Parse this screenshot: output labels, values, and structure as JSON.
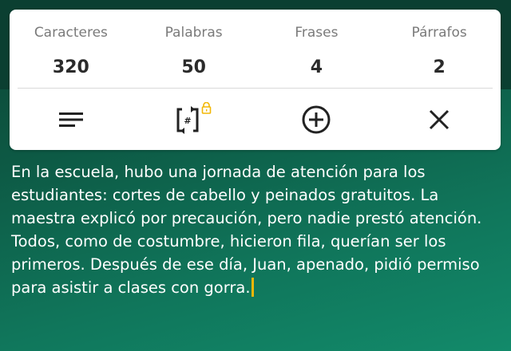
{
  "stats": [
    {
      "label": "Caracteres",
      "value": "320"
    },
    {
      "label": "Palabras",
      "value": "50"
    },
    {
      "label": "Frases",
      "value": "4"
    },
    {
      "label": "Párrafos",
      "value": "2"
    }
  ],
  "toolbar": {
    "icons": [
      "format-align-icon",
      "counter-mode-icon",
      "add-circle-icon",
      "close-icon"
    ],
    "locked_icon": "lock-icon",
    "accent_color": "#f2b705"
  },
  "editor": {
    "text": "En la escuela, hubo una jornada de atención para los estudiantes: cortes de cabello y peinados gratuitos. La maestra explicó por precaución, pero nadie prestó atención. Todos, como de costumbre, hicieron fila, querían ser los primeros. Después de ese día, Juan, apenado, pidió permiso para asistir a clases con gorra."
  },
  "colors": {
    "background_top": "#0b3f31",
    "background_bottom": "#128a6a",
    "text": "#ffffff",
    "caret": "#f2b705"
  }
}
